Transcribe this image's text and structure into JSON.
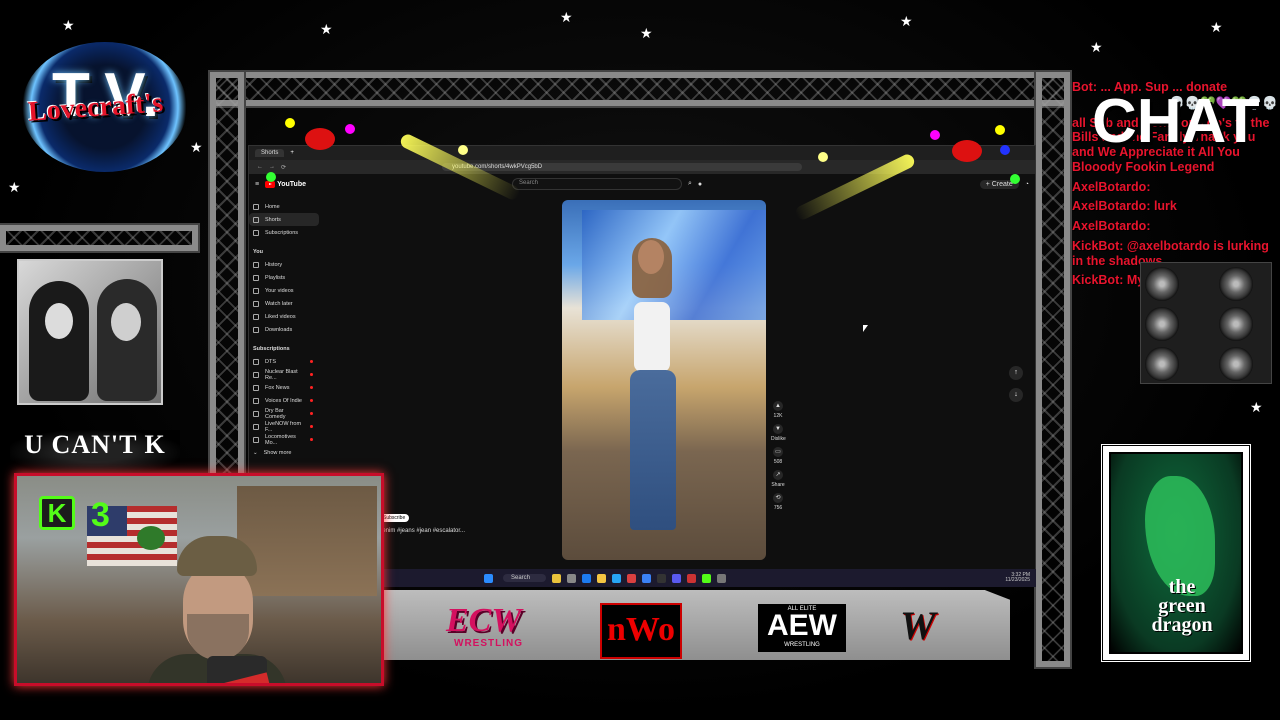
{
  "overlay": {
    "logo": {
      "name": "Lovecraft's",
      "tv": "T.V."
    },
    "side_badge": "U CAN'T K",
    "kick": {
      "icon": "K",
      "number": "3"
    },
    "chat": {
      "title": "CHAT",
      "messages": [
        "Bot: ... App. Sup ... donate",
        "all Sub and Donations go's to the Bills and the Family Thank you and We Appreciate it All You Blooody Fookin Legend",
        "AxelBotardo:",
        "AxelBotardo: lurk",
        "AxelBotardo:",
        "KickBot: @axelbotardo is lurking in the shadows",
        "KickBot: My Friends Never Eve"
      ],
      "emotes": "💀💀💚💜💚💀💀"
    },
    "promotions": {
      "ecw": "ECW",
      "ecw_sub": "WRESTLING",
      "nwo": "nWo",
      "aew": "AEW",
      "aew_top": "ALL ELITE",
      "aew_bottom": "WRESTLING",
      "wwe": "W"
    },
    "dragon": {
      "line1": "the",
      "line2": "green",
      "line3": "dragon"
    }
  },
  "browser": {
    "tabs": [
      "Shorts",
      "+"
    ],
    "url": "youtube.com/shorts/4wkPVcg5bD",
    "youtube": {
      "logo": "YouTube",
      "search_placeholder": "Search",
      "create": "+ Create"
    },
    "sidebar": {
      "main": [
        {
          "label": "Home",
          "icon": "home-icon"
        },
        {
          "label": "Shorts",
          "icon": "shorts-icon",
          "active": true
        },
        {
          "label": "Subscriptions",
          "icon": "subscriptions-icon"
        }
      ],
      "you_header": "You",
      "you": [
        {
          "label": "History",
          "icon": "history-icon"
        },
        {
          "label": "Playlists",
          "icon": "playlists-icon"
        },
        {
          "label": "Your videos",
          "icon": "your-videos-icon"
        },
        {
          "label": "Watch later",
          "icon": "watch-later-icon"
        },
        {
          "label": "Liked videos",
          "icon": "liked-videos-icon"
        },
        {
          "label": "Downloads",
          "icon": "downloads-icon"
        }
      ],
      "subs_header": "Subscriptions",
      "subs": [
        {
          "label": "DTS"
        },
        {
          "label": "Nuclear Blast Re..."
        },
        {
          "label": "Fox News"
        },
        {
          "label": "Voices Of Indie"
        },
        {
          "label": "Dry Bar Comedy"
        },
        {
          "label": "LiveNOW from F..."
        },
        {
          "label": "Locomotives Mo..."
        }
      ],
      "show_more": "Show more"
    },
    "short": {
      "caption": "denim #jeans #jean #escalator...",
      "chip": "Subscribe",
      "actions": [
        {
          "icon": "like-icon",
          "label": "12K"
        },
        {
          "icon": "dislike-icon",
          "label": "Dislike"
        },
        {
          "icon": "comment-icon",
          "label": "508"
        },
        {
          "icon": "share-icon",
          "label": "Share"
        },
        {
          "icon": "remix-icon",
          "label": "756"
        }
      ]
    },
    "nav": {
      "up": "↑",
      "down": "↓"
    }
  },
  "taskbar": {
    "search": "Search",
    "time": "3:32 PM",
    "date": "11/23/2025"
  }
}
